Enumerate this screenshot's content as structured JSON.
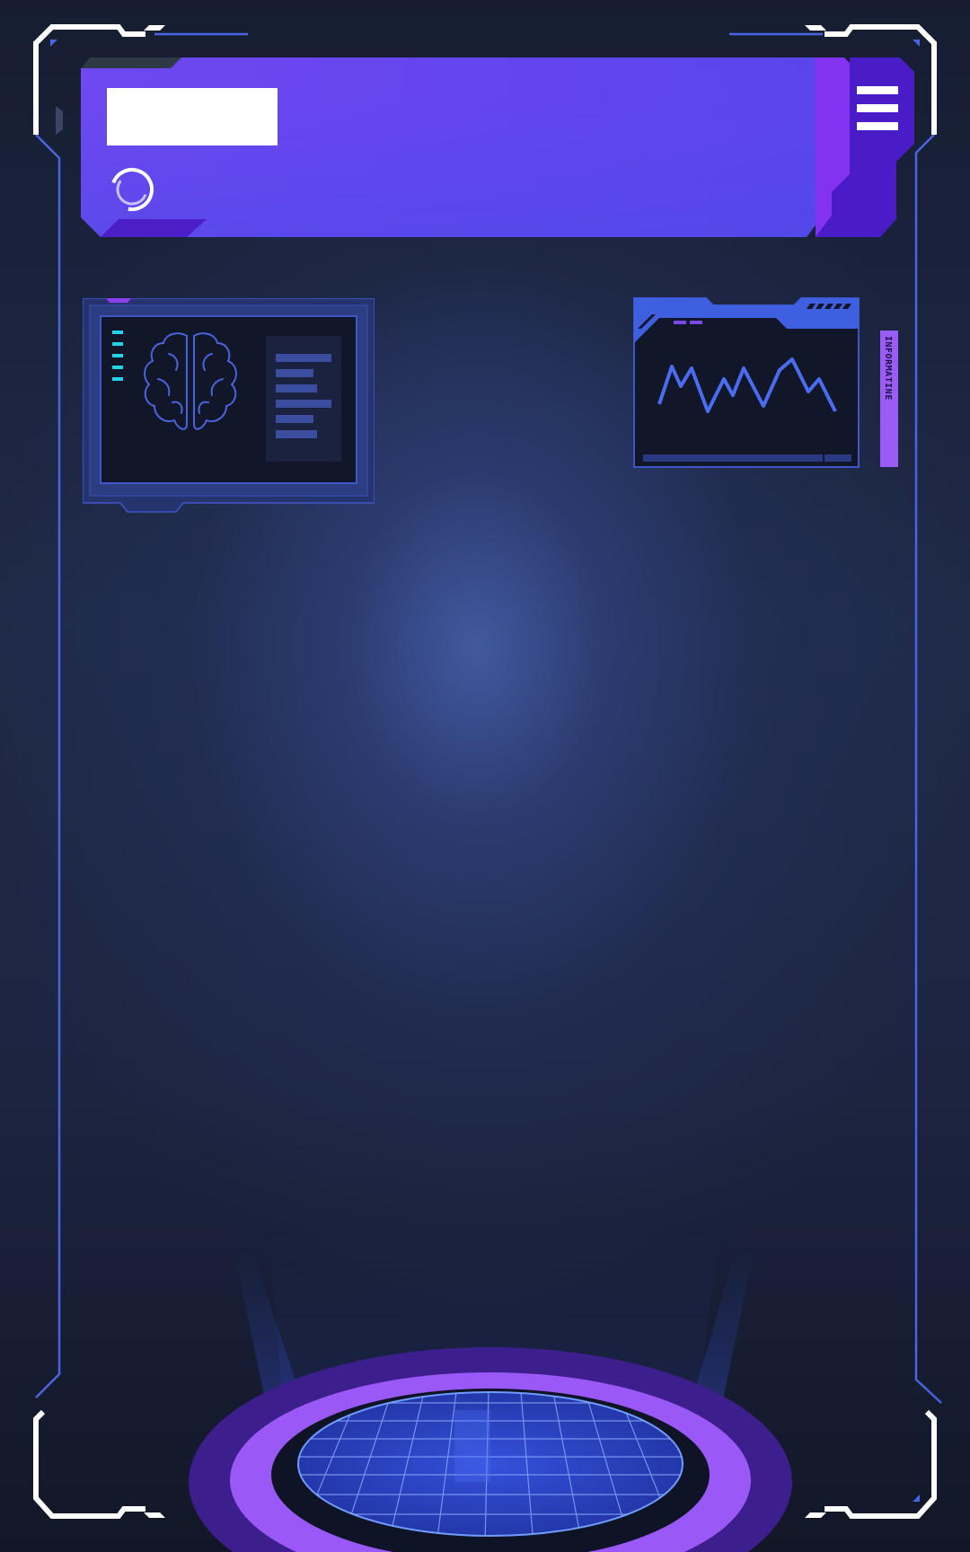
{
  "header": {
    "title": "",
    "menu_icon": "hamburger-menu-icon",
    "loading_icon": "loading-spinner-icon"
  },
  "panels": {
    "brain_panel_icon": "brain-icon",
    "chart_panel_icon": "line-chart-icon",
    "side_tab_label": "INFORMATINE"
  },
  "colors": {
    "background": "#1c2440",
    "accent_purple": "#6b46f0",
    "accent_violet": "#8b3ff0",
    "frame_blue": "#4a63e0",
    "cyan": "#1fd6e8",
    "white": "#ffffff"
  }
}
